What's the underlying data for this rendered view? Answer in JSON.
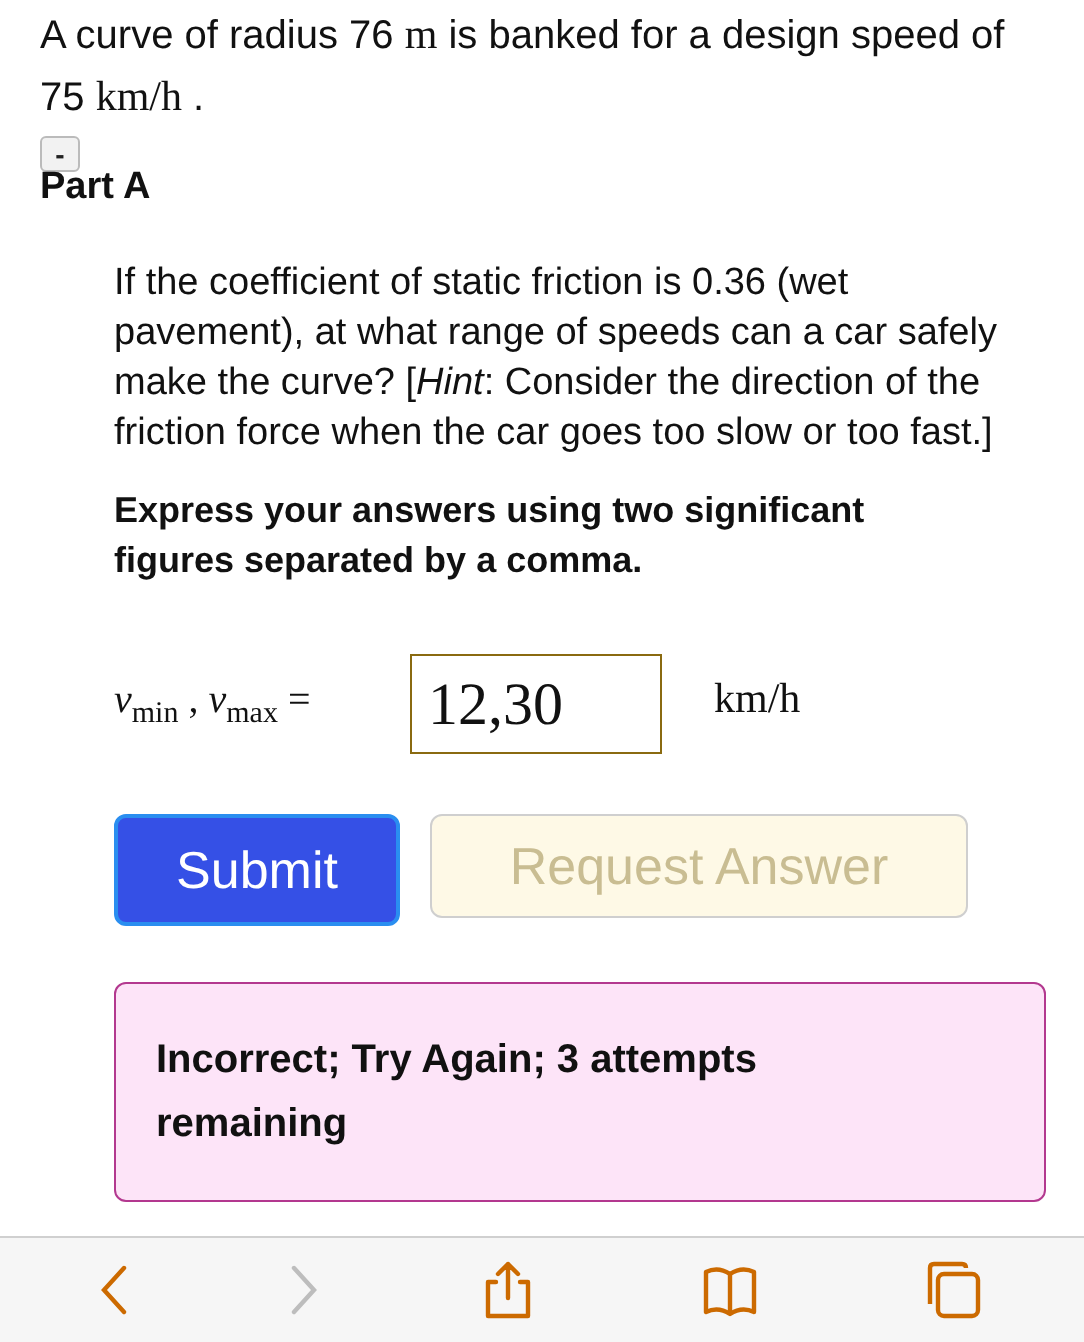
{
  "problem": {
    "intro": [
      {
        "kind": "text",
        "text": "A curve of radius 76 "
      },
      {
        "kind": "math",
        "text": "m"
      },
      {
        "kind": "text",
        "text": " is banked for a design speed of 75 "
      },
      {
        "kind": "math",
        "text": "km/h"
      },
      {
        "kind": "text",
        "text": " ."
      }
    ]
  },
  "part": {
    "collapse_icon": "-",
    "title": "Part A",
    "question": "If the coefficient of static friction is 0.36 (wet pavement), at what range of speeds can a car safely make the curve? [*Hint*: Consider the direction of the friction force when the car goes too slow or too fast.]",
    "instruction": "Express your answers using two significant figures separated by a comma.",
    "answer": {
      "label": "*v*$_{min}$ , *v*$_{max}$ =",
      "value": "12,30",
      "unit": "km/h"
    },
    "buttons": [
      {
        "label": "Submit",
        "disabled": false,
        "kind": "primary"
      },
      {
        "label": "Request Answer",
        "disabled": true,
        "kind": "secondary"
      }
    ],
    "feedback": {
      "text": "Incorrect; Try Again; 3 attempts remaining"
    }
  },
  "toolbar": [
    {
      "kind": "back",
      "disabled": false
    },
    {
      "kind": "forward",
      "disabled": true
    },
    {
      "kind": "share",
      "disabled": false
    },
    {
      "kind": "bookmarks",
      "disabled": false
    },
    {
      "kind": "tabs",
      "disabled": false
    }
  ]
}
